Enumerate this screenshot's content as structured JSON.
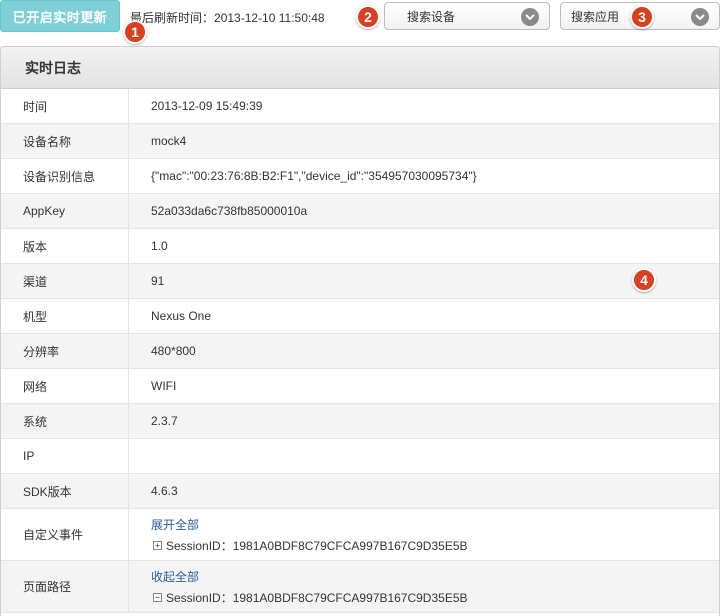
{
  "topbar": {
    "realtime_button": "已开启实时更新",
    "refresh_label": "最后刷新时间：",
    "refresh_time": "2013-12-10 11:50:48",
    "device_select": "搜索设备",
    "app_select": "搜索应用"
  },
  "badges": [
    "1",
    "2",
    "3",
    "4"
  ],
  "panel": {
    "title": "实时日志",
    "rows": [
      {
        "label": "时间",
        "value": "2013-12-09 15:49:39"
      },
      {
        "label": "设备名称",
        "value": "mock4"
      },
      {
        "label": "设备识别信息",
        "value": "{\"mac\":\"00:23:76:8B:B2:F1\",\"device_id\":\"354957030095734\"}"
      },
      {
        "label": "AppKey",
        "value": "52a033da6c738fb85000010a"
      },
      {
        "label": "版本",
        "value": "1.0"
      },
      {
        "label": "渠道",
        "value": "91"
      },
      {
        "label": "机型",
        "value": "Nexus One"
      },
      {
        "label": "分辨率",
        "value": "480*800"
      },
      {
        "label": "网络",
        "value": "WIFI"
      },
      {
        "label": "系统",
        "value": "2.3.7"
      },
      {
        "label": "IP",
        "value": ""
      },
      {
        "label": "SDK版本",
        "value": "4.6.3"
      }
    ],
    "custom_events": {
      "label": "自定义事件",
      "link": "展开全部",
      "tree_icon": "+",
      "session": "SessionID：1981A0BDF8C79CFCA997B167C9D35E5B"
    },
    "page_path": {
      "label": "页面路径",
      "link": "收起全部",
      "tree_icon": "−",
      "session": "SessionID：1981A0BDF8C79CFCA997B167C9D35E5B"
    }
  },
  "colors": {
    "accent": "#7fd0d6",
    "badge": "#d9401f",
    "link": "#2a5d9f"
  }
}
